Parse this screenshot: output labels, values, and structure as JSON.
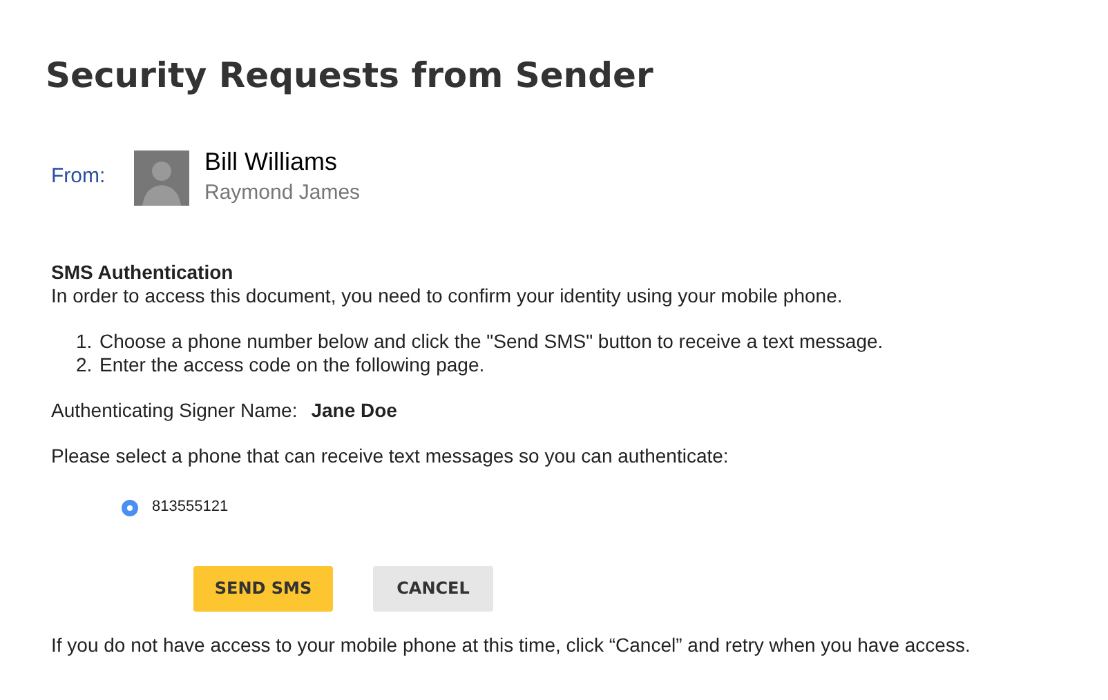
{
  "title": "Security Requests from Sender",
  "sender": {
    "label": "From:",
    "name": "Bill Williams",
    "company": "Raymond James"
  },
  "section": {
    "heading": "SMS Authentication",
    "intro": "In order to access this document, you need to confirm your identity using your mobile phone.",
    "steps": [
      {
        "number": "1.",
        "text": "Choose a phone number below and click the \"Send SMS\" button to receive a text message."
      },
      {
        "number": "2.",
        "text": "Enter the access code on the following page."
      }
    ],
    "signer_label": "Authenticating Signer Name:",
    "signer_name": "Jane Doe",
    "prompt": "Please select a phone that can receive text messages so you can authenticate:",
    "phones": [
      {
        "number": "813555121",
        "selected": true
      }
    ]
  },
  "buttons": [
    {
      "kind": "primary",
      "label": "SEND SMS"
    },
    {
      "kind": "secondary",
      "label": "CANCEL"
    }
  ],
  "footer": "If you do not have access to your mobile phone at this time, click “Cancel” and retry when you have access."
}
